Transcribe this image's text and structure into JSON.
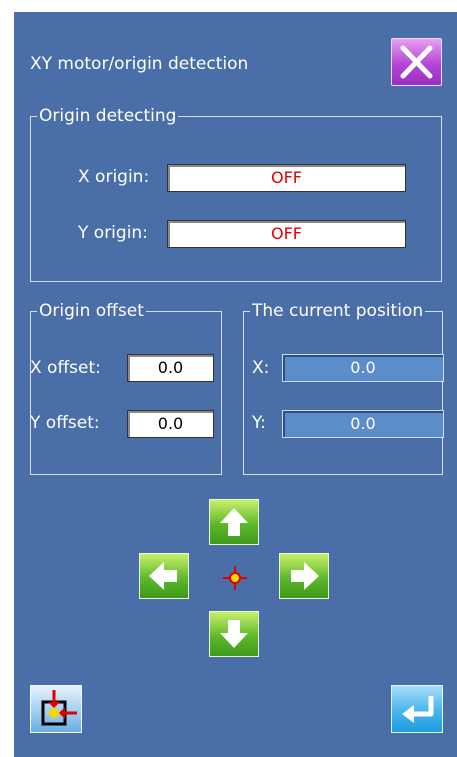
{
  "header": {
    "title": "XY motor/origin detection"
  },
  "origin_detecting": {
    "legend": "Origin detecting",
    "x_label": "X origin:",
    "x_value": "OFF",
    "y_label": "Y origin:",
    "y_value": "OFF"
  },
  "origin_offset": {
    "legend": "Origin offset",
    "x_label": "X offset:",
    "x_value": "0.0",
    "y_label": "Y offset:",
    "y_value": "0.0"
  },
  "current_position": {
    "legend": "The current position",
    "x_label": "X:",
    "x_value": "0.0",
    "y_label": "Y:",
    "y_value": "0.0"
  },
  "icons": {
    "close": "close-icon",
    "arrow_up": "arrow-up-icon",
    "arrow_left": "arrow-left-icon",
    "arrow_right": "arrow-right-icon",
    "arrow_down": "arrow-down-icon",
    "crosshair": "crosshair-icon",
    "origin_detect": "origin-detect-icon",
    "enter": "enter-icon"
  },
  "colors": {
    "background": "#4a6ea8",
    "off_text": "#e00000",
    "close_button": "#b446d6",
    "arrow_button": "#5fb82b",
    "enter_button": "#46b5ec"
  }
}
